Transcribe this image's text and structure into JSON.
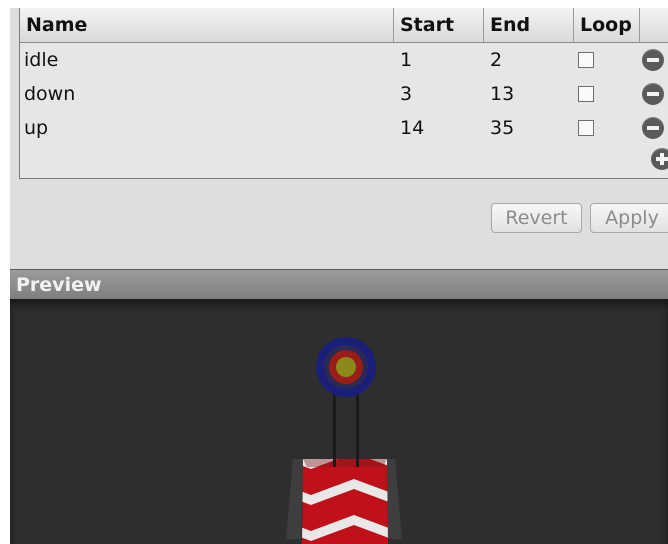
{
  "table": {
    "headers": {
      "name": "Name",
      "start": "Start",
      "end": "End",
      "loop": "Loop"
    },
    "rows": [
      {
        "name": "idle",
        "start": "1",
        "end": "2",
        "loop": false
      },
      {
        "name": "down",
        "start": "3",
        "end": "13",
        "loop": false
      },
      {
        "name": "up",
        "start": "14",
        "end": "35",
        "loop": false
      }
    ]
  },
  "actions": {
    "revert_label": "Revert",
    "apply_label": "Apply"
  },
  "preview": {
    "title": "Preview"
  },
  "icons": {
    "remove": "minus-circle-icon",
    "add": "plus-circle-icon"
  },
  "colors": {
    "panel_bg": "#dedede",
    "viewport_bg": "#2e2e2e",
    "target_ring_outer": "#1a1f7a",
    "target_ring_inner": "#9a1d17",
    "target_center": "#8a8a1a",
    "stripe_red": "#c0101a",
    "stripe_white": "#e8e8e8"
  }
}
